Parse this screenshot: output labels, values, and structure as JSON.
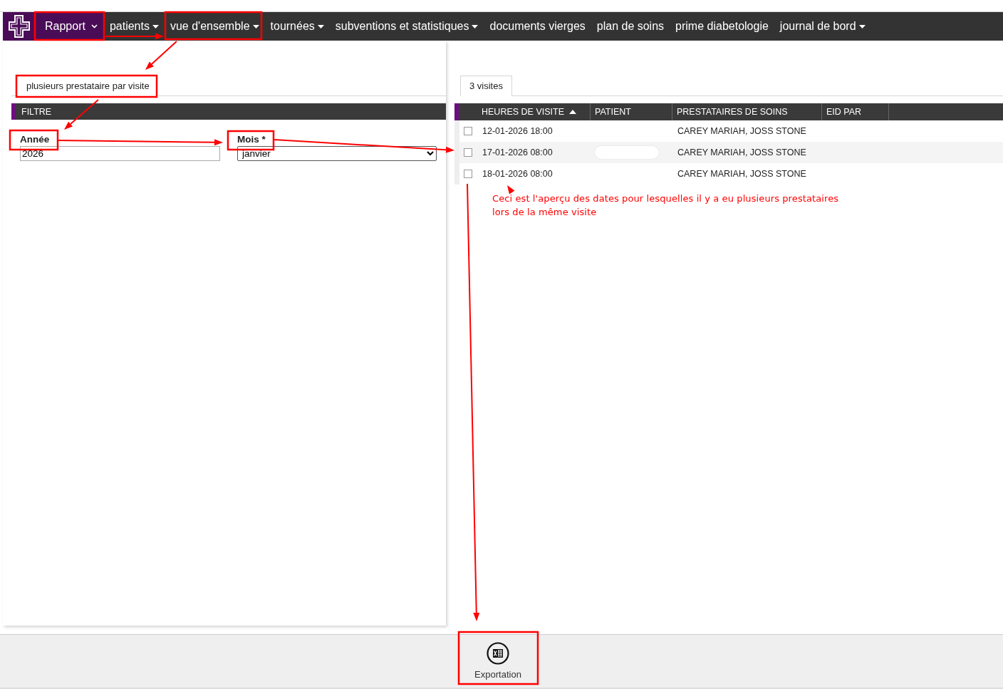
{
  "navbar": {
    "items": [
      {
        "label": "Rapport",
        "kind": "chevron",
        "selected": true
      },
      {
        "label": "patients",
        "kind": "dropdown",
        "selected": false
      },
      {
        "label": "vue d'ensemble",
        "kind": "dropdown",
        "selected": false
      },
      {
        "label": "tournées",
        "kind": "dropdown",
        "selected": false
      },
      {
        "label": "subventions et statistiques",
        "kind": "dropdown",
        "selected": false
      },
      {
        "label": "documents vierges",
        "kind": "link",
        "selected": false
      },
      {
        "label": "plan de soins",
        "kind": "link",
        "selected": false
      },
      {
        "label": "prime diabetologie",
        "kind": "link",
        "selected": false
      },
      {
        "label": "journal de bord",
        "kind": "dropdown",
        "selected": false
      }
    ]
  },
  "filter_panel": {
    "tab": {
      "label": "plusieurs prestataire par visite",
      "selected": true
    },
    "header": "FILTRE",
    "fields": [
      {
        "label": "Année",
        "kind": "text",
        "value": "2026"
      },
      {
        "label": "Mois *",
        "kind": "select",
        "value": "janvier"
      }
    ]
  },
  "results": {
    "tab": {
      "label": "3 visites",
      "selected": true
    },
    "columns": [
      {
        "label": "HEURES DE VISITE",
        "sorted": true
      },
      {
        "label": "PATIENT",
        "sorted": false
      },
      {
        "label": "PRESTATAIRES DE SOINS",
        "sorted": false
      },
      {
        "label": "EID PAR",
        "sorted": false
      }
    ],
    "rows": [
      {
        "checked": false,
        "visit_time": "12-01-2026 18:00",
        "patient_redacted": false,
        "providers": "CAREY MARIAH, JOSS STONE"
      },
      {
        "checked": false,
        "visit_time": "17-01-2026 08:00",
        "patient_redacted": true,
        "providers": "CAREY MARIAH, JOSS STONE"
      },
      {
        "checked": false,
        "visit_time": "18-01-2026 08:00",
        "patient_redacted": false,
        "providers": "CAREY MARIAH, JOSS STONE"
      }
    ]
  },
  "footer": {
    "buttons": [
      {
        "label": "Exportation",
        "kind": "excel-export"
      }
    ]
  },
  "annotation": {
    "note": "Ceci est l'aperçu des dates pour lesquelles il y a eu plusieurs prestataires lors de la même visite"
  }
}
